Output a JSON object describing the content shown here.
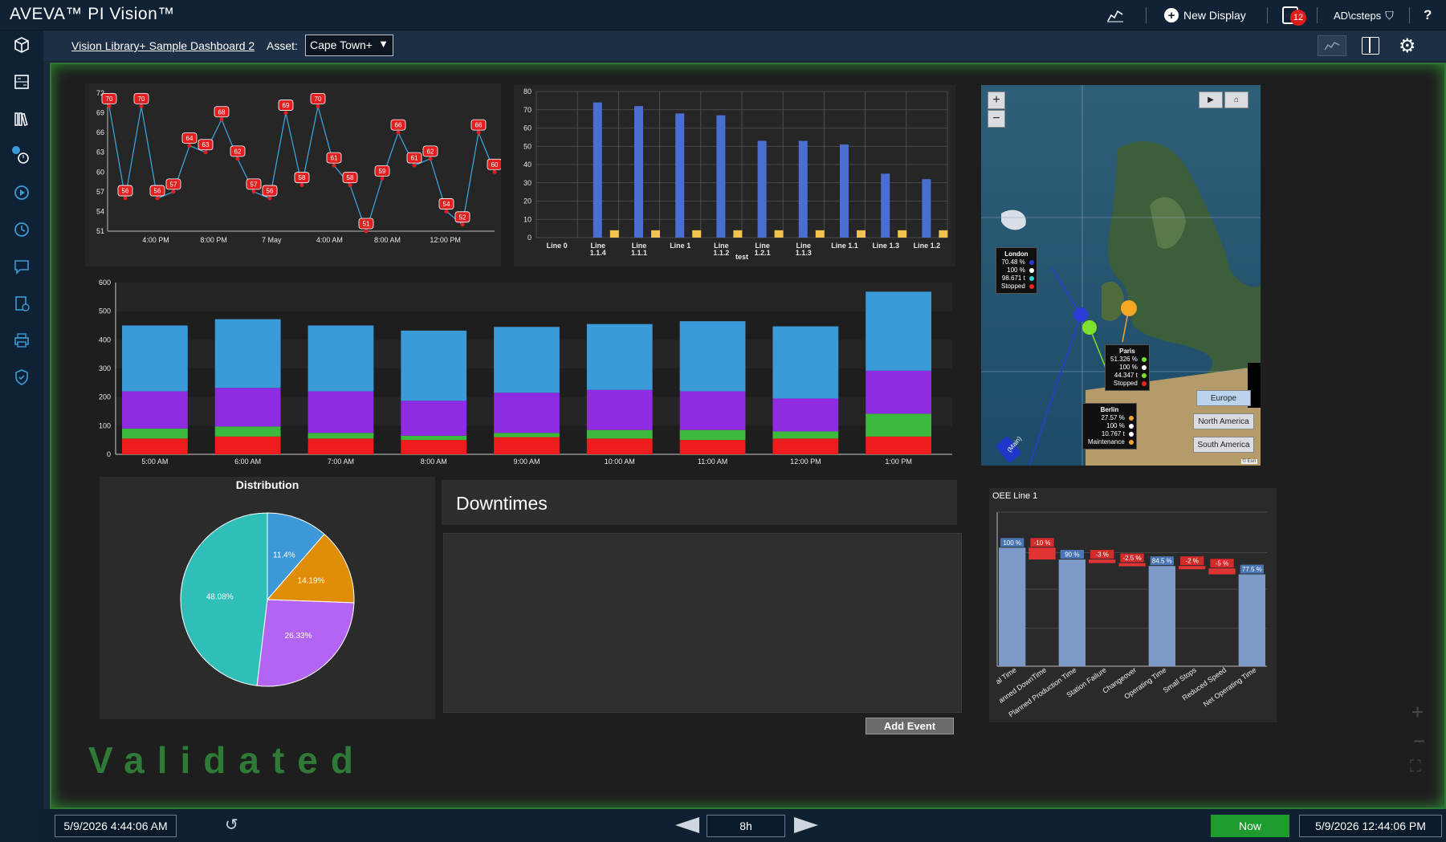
{
  "app": {
    "brand": "AVEVA™ PI Vision™",
    "new_display": "New Display",
    "notification_count": "12",
    "user": "AD\\csteps",
    "help": "?"
  },
  "subbar": {
    "dashboard_link": "Vision Library+ Sample Dashboard 2",
    "asset_label": "Asset:",
    "asset_value": "Cape Town+"
  },
  "sidebar": {
    "icons": [
      "cube-icon",
      "calculator-icon",
      "library-icon",
      "event-icon",
      "playback-icon",
      "history-icon",
      "comment-icon",
      "report-icon",
      "print-icon",
      "shield-icon"
    ]
  },
  "line_chart": {
    "y_ticks": [
      "72",
      "69",
      "66",
      "63",
      "60",
      "57",
      "54",
      "51"
    ],
    "x_ticks": [
      "4:00 PM",
      "8:00 PM",
      "7 May",
      "4:00 AM",
      "8:00 AM",
      "12:00 PM"
    ]
  },
  "chart_data": [
    {
      "type": "line",
      "points": [
        70,
        56,
        70,
        56,
        57,
        64,
        63,
        68,
        62,
        57,
        56,
        69,
        58,
        70,
        61,
        58,
        51,
        59,
        66,
        61,
        62,
        54,
        52,
        66,
        60
      ],
      "point_labels": [
        "70",
        "56",
        "70",
        "56",
        "57",
        "64",
        "63",
        "68",
        "62",
        "57",
        "56",
        "69",
        "58",
        "70",
        "61",
        "58",
        "51",
        "59",
        "66",
        "61",
        "62",
        "54",
        "52",
        "66",
        "60"
      ],
      "ylim": [
        51,
        72
      ],
      "colors": {
        "line": "#3ba0d8",
        "marker": "#e02020"
      }
    },
    {
      "type": "bar",
      "categories": [
        "Line 0",
        "Line 1.1.4",
        "Line 1.1.1",
        "Line 1",
        "Line 1.1.2",
        "Line 1.2.1",
        "Line 1.1.3",
        "Line 1.1",
        "Line 1.3",
        "Line 1.2"
      ],
      "category_lines": [
        [
          "Line 0"
        ],
        [
          "Line",
          "1.1.4"
        ],
        [
          "Line",
          "1.1.1"
        ],
        [
          "Line 1"
        ],
        [
          "Line",
          "1.1.2"
        ],
        [
          "Line",
          "1.2.1"
        ],
        [
          "Line",
          "1.1.3"
        ],
        [
          "Line 1.1"
        ],
        [
          "Line 1.3"
        ],
        [
          "Line 1.2"
        ]
      ],
      "series": [
        {
          "values": [
            0,
            74,
            72,
            68,
            67,
            53,
            53,
            51,
            35,
            32
          ],
          "color": "#4a6fd1"
        },
        {
          "values": [
            0,
            4,
            4,
            4,
            4,
            4,
            4,
            4,
            4,
            4
          ],
          "color": "#f2c24e"
        }
      ],
      "xlabel": "test",
      "ylim": [
        0,
        80
      ],
      "y_ticks": [
        "80",
        "70",
        "60",
        "50",
        "40",
        "30",
        "20",
        "10",
        "0"
      ]
    },
    {
      "type": "bar",
      "stacked": true,
      "categories": [
        "5:00 AM",
        "6:00 AM",
        "7:00 AM",
        "8:00 AM",
        "9:00 AM",
        "10:00 AM",
        "11:00 AM",
        "12:00 PM",
        "1:00 PM"
      ],
      "series": [
        {
          "values": [
            55,
            62,
            55,
            50,
            60,
            55,
            50,
            55,
            62
          ],
          "color": "#ee1c1c"
        },
        {
          "values": [
            35,
            35,
            20,
            15,
            15,
            30,
            35,
            25,
            80
          ],
          "color": "#3dba3d"
        },
        {
          "values": [
            130,
            135,
            145,
            122,
            140,
            140,
            135,
            115,
            150
          ],
          "color": "#8f2be0"
        },
        {
          "values": [
            230,
            240,
            230,
            245,
            230,
            230,
            245,
            252,
            276
          ],
          "color": "#3b9ad8"
        }
      ],
      "ylim": [
        0,
        600
      ],
      "y_ticks": [
        "600",
        "500",
        "400",
        "300",
        "200",
        "100",
        "0"
      ]
    },
    {
      "type": "pie",
      "title": "Distribution",
      "slices": [
        {
          "label": "11.4%",
          "value": 11.4,
          "color": "#3d98d8"
        },
        {
          "label": "14.19%",
          "value": 14.19,
          "color": "#e08d07"
        },
        {
          "label": "26.33%",
          "value": 26.33,
          "color": "#b464f2"
        },
        {
          "label": "48.08%",
          "value": 48.08,
          "color": "#2fbfb8"
        }
      ]
    },
    {
      "type": "bar",
      "title": "OEE Line 1",
      "subtype": "waterfall",
      "categories": [
        "Total Time",
        "Planned DownTime",
        "Planned Production Time",
        "Station Failure",
        "Changeover",
        "Operating Time",
        "Small Stops",
        "Reduced Speed",
        "Net Operating Time"
      ],
      "tick_labels": [
        "al Time",
        "anned DownTime",
        "Planned Production Time",
        "Station Failure",
        "Changeover",
        "Operating Time",
        "Small Stops",
        "Reduced Speed",
        "Net Operating Time"
      ],
      "values": [
        100,
        -10,
        90,
        -3,
        -2.5,
        84.5,
        -2,
        -5,
        77.5
      ],
      "value_labels": [
        "100 %",
        "-10 %",
        "90 %",
        "-3 %",
        "-2.5 %",
        "84.5 %",
        "-2 %",
        "-5 %",
        "77.5 %"
      ],
      "colors": {
        "total": "#7d9bc8",
        "loss": "#e03434",
        "label_total": "#4a76b5",
        "label_loss": "#d42a2a"
      }
    }
  ],
  "map": {
    "zoom_in": "+",
    "zoom_out": "−",
    "regions": [
      "Europe",
      "North America",
      "South America"
    ],
    "popups": [
      {
        "name": "London",
        "lines": [
          "70.48 %",
          "100 %",
          "98.671 t",
          "Stopped"
        ],
        "dots": [
          "#2a3bd8",
          "#ffffff",
          "#33d6d6",
          "#ee2222"
        ]
      },
      {
        "name": "Paris",
        "lines": [
          "51.326 %",
          "100 %",
          "44.347 t",
          "Stopped"
        ],
        "dots": [
          "#7de02a",
          "#ffffff",
          "#7de02a",
          "#ee2222"
        ]
      },
      {
        "name": "Berlin",
        "lines": [
          "27.57 %",
          "100 %",
          "10.767 t",
          "Maintenance"
        ],
        "dots": [
          "#f5a623",
          "#ffffff",
          "#ffffff",
          "#f5a623"
        ]
      }
    ],
    "route_label": "(Main)",
    "attribution": "© Esri"
  },
  "downtimes": {
    "title": "Downtimes",
    "add_event": "Add Event"
  },
  "watermark": "Validated",
  "timebar": {
    "start": "5/9/2026 4:44:06 AM",
    "duration": "8h",
    "now": "Now",
    "end": "5/9/2026 12:44:06 PM"
  }
}
